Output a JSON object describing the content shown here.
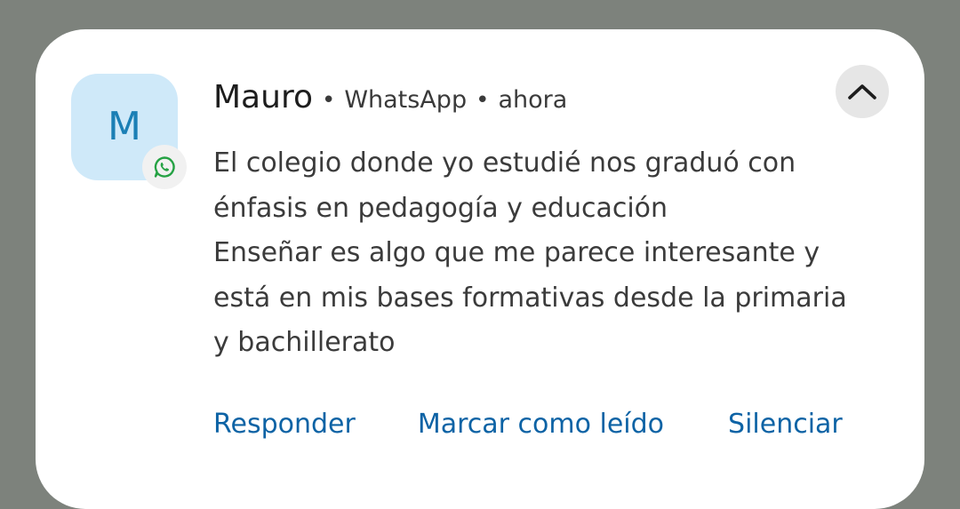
{
  "notification": {
    "avatar_letter": "M",
    "sender": "Mauro",
    "app": "WhatsApp",
    "time": "ahora",
    "separator": "•",
    "message_lines": [
      "El colegio donde yo estudié nos graduó con",
      "énfasis en pedagogía y educación",
      "Enseñar es algo que me parece interesante y",
      "está en mis bases formativas desde la primaria",
      "y bachillerato"
    ],
    "actions": {
      "reply": "Responder",
      "mark_read": "Marcar como leído",
      "mute": "Silenciar"
    },
    "icons": {
      "app_badge": "whatsapp-icon",
      "collapse": "chevron-up-icon"
    }
  },
  "colors": {
    "backdrop": "#7d827c",
    "card": "#ffffff",
    "avatar_bg": "#cfe9f9",
    "avatar_letter": "#1b7fb5",
    "action_text": "#0d63a5",
    "whatsapp_green": "#25a244"
  }
}
